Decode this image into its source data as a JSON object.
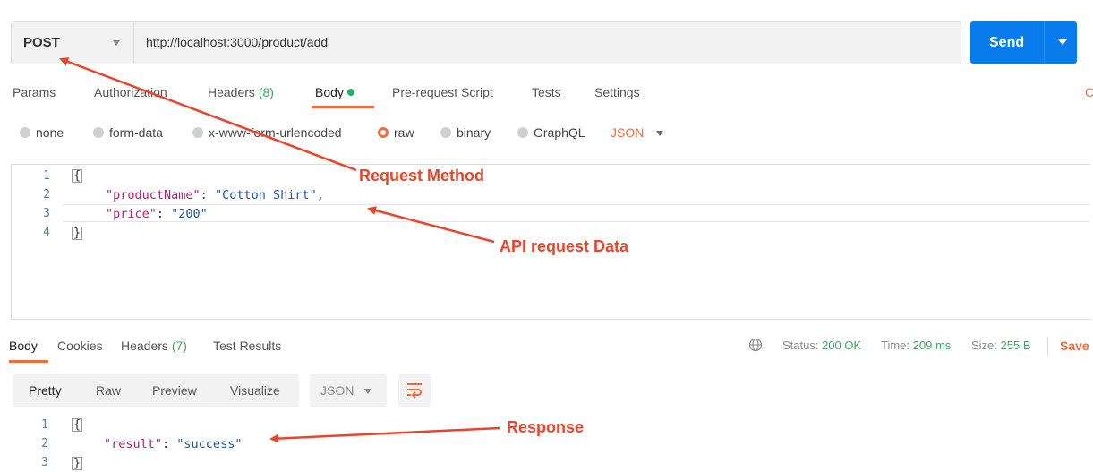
{
  "request": {
    "method": "POST",
    "url": "http://localhost:3000/product/add",
    "send_label": "Send"
  },
  "request_tabs": {
    "params": "Params",
    "authorization": "Authorization",
    "headers": "Headers",
    "headers_count": "(8)",
    "body": "Body",
    "prerequest": "Pre-request Script",
    "tests": "Tests",
    "settings": "Settings",
    "cut_label": "C"
  },
  "body_types": {
    "none": "none",
    "form_data": "form-data",
    "urlencoded": "x-www-form-urlencoded",
    "raw": "raw",
    "binary": "binary",
    "graphql": "GraphQL",
    "language": "JSON"
  },
  "request_body": {
    "line_numbers": [
      "1",
      "2",
      "3",
      "4"
    ],
    "open_brace": "{",
    "key1": "\"productName\"",
    "value1": "\"Cotton Shirt\"",
    "key2": "\"price\"",
    "value2": "\"200\"",
    "close_brace": "}"
  },
  "response_tabs": {
    "body": "Body",
    "cookies": "Cookies",
    "headers": "Headers",
    "headers_count": "(7)",
    "test_results": "Test Results"
  },
  "response_status": {
    "status_label": "Status:",
    "status_value": "200 OK",
    "time_label": "Time:",
    "time_value": "209 ms",
    "size_label": "Size:",
    "size_value": "255 B",
    "save_label": "Save"
  },
  "response_view": {
    "pretty": "Pretty",
    "raw": "Raw",
    "preview": "Preview",
    "visualize": "Visualize",
    "format": "JSON"
  },
  "response_body": {
    "line_numbers": [
      "1",
      "2",
      "3"
    ],
    "open_brace": "{",
    "key1": "\"result\"",
    "value1": "\"success\"",
    "close_brace": "}"
  },
  "annotations": {
    "request_method": "Request Method",
    "api_request_data": "API request Data",
    "response": "Response"
  },
  "colors": {
    "accent": "#f26b3a",
    "send_button": "#097bed",
    "annotation": "#e8452c",
    "success": "#3aa85f"
  }
}
